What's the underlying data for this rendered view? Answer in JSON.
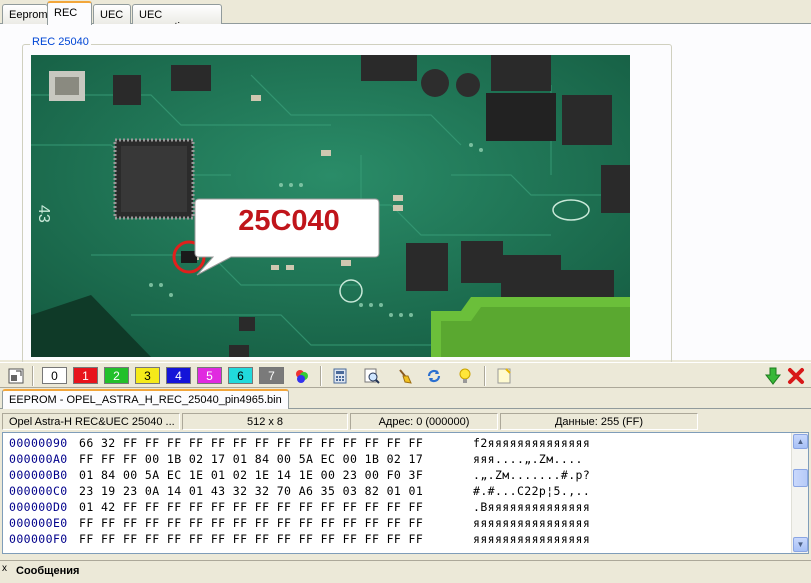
{
  "tabs": [
    {
      "label": "Eeprom",
      "active": false
    },
    {
      "label": "REC",
      "active": true
    },
    {
      "label": "UEC",
      "active": false
    },
    {
      "label": "UEC connection",
      "active": false
    }
  ],
  "group": {
    "title": "REC 25040"
  },
  "photo": {
    "callout_text": "25C040"
  },
  "toolbar": {
    "color_buttons": [
      {
        "label": "0",
        "color": "#ffffff",
        "text_color": "#000000"
      },
      {
        "label": "1",
        "color": "#e8141c",
        "text_color": "#ffffff"
      },
      {
        "label": "2",
        "color": "#22c02a",
        "text_color": "#ffffff"
      },
      {
        "label": "3",
        "color": "#f5ea1a",
        "text_color": "#000000"
      },
      {
        "label": "4",
        "color": "#1414d8",
        "text_color": "#ffffff"
      },
      {
        "label": "5",
        "color": "#e02ae0",
        "text_color": "#ffffff"
      },
      {
        "label": "6",
        "color": "#21dadc",
        "text_color": "#000000"
      },
      {
        "label": "7",
        "color": "#7a7a7a",
        "text_color": "#ffffff"
      }
    ]
  },
  "file_tab": {
    "label": "EEPROM - OPEL_ASTRA_H_REC_25040_pin4965.bin"
  },
  "info": {
    "device": "Opel Astra-H REC&UEC 25040 ...",
    "size": "512 x 8",
    "address": "Адрес: 0 (000000)",
    "data": "Данные: 255 (FF)"
  },
  "hex_rows": [
    {
      "addr": "00000090",
      "bytes": "66 32 FF FF FF FF FF FF FF FF FF FF FF FF FF FF",
      "ascii": "f2яяяяяяяяяяяяяя"
    },
    {
      "addr": "000000A0",
      "bytes": "FF FF FF 00 1B 02 17 01 84 00 5A EC 00 1B 02 17",
      "ascii": "яяя....„.Zм...."
    },
    {
      "addr": "000000B0",
      "bytes": "01 84 00 5A EC 1E 01 02 1E 14 1E 00 23 00 F0 3F",
      "ascii": ".„.Zм.......#.р?"
    },
    {
      "addr": "000000C0",
      "bytes": "23 19 23 0A 14 01 43 32 32 70 A6 35 03 82 01 01",
      "ascii": "#.#...C22p¦5.‚.."
    },
    {
      "addr": "000000D0",
      "bytes": "01 42 FF FF FF FF FF FF FF FF FF FF FF FF FF FF",
      "ascii": ".Bяяяяяяяяяяяяяя"
    },
    {
      "addr": "000000E0",
      "bytes": "FF FF FF FF FF FF FF FF FF FF FF FF FF FF FF FF",
      "ascii": "яяяяяяяяяяяяяяяя"
    },
    {
      "addr": "000000F0",
      "bytes": "FF FF FF FF FF FF FF FF FF FF FF FF FF FF FF FF",
      "ascii": "яяяяяяяяяяяяяяяя"
    }
  ],
  "messages": {
    "title": "Сообщения",
    "close_glyph": "x"
  }
}
